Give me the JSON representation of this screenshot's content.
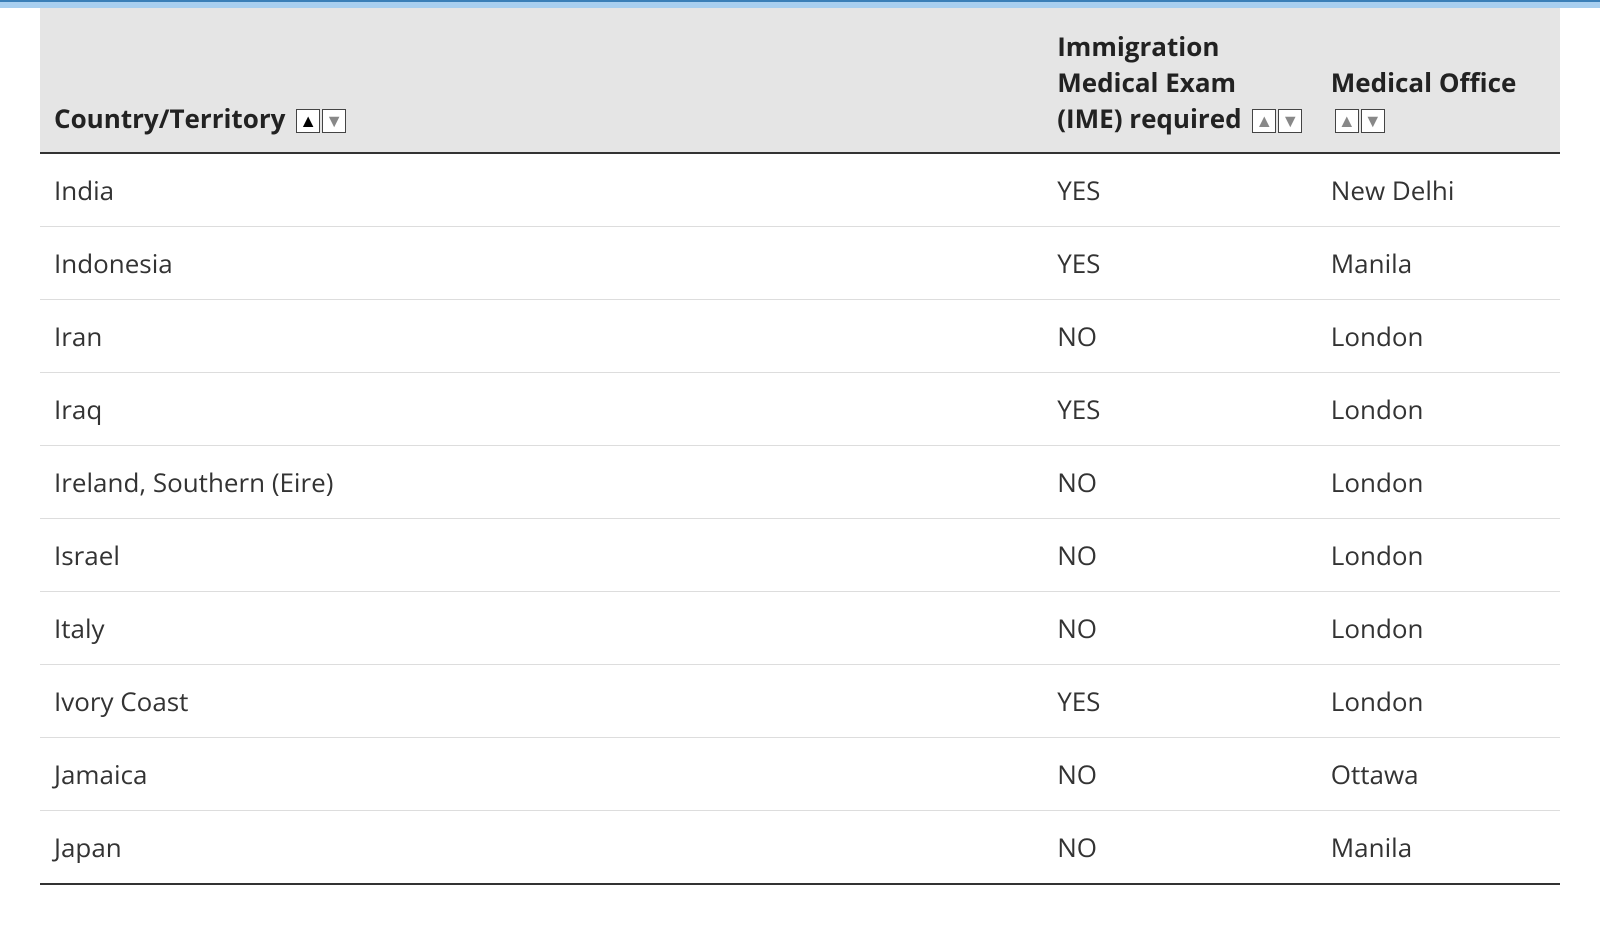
{
  "table": {
    "headers": {
      "country": "Country/Territory",
      "ime": "Immigration Medical Exam (IME) required",
      "office": "Medical Office"
    },
    "rows": [
      {
        "country": "India",
        "ime": "YES",
        "office": "New Delhi"
      },
      {
        "country": "Indonesia",
        "ime": "YES",
        "office": "Manila"
      },
      {
        "country": "Iran",
        "ime": "NO",
        "office": "London"
      },
      {
        "country": "Iraq",
        "ime": "YES",
        "office": "London"
      },
      {
        "country": "Ireland, Southern (Eire)",
        "ime": "NO",
        "office": "London"
      },
      {
        "country": "Israel",
        "ime": "NO",
        "office": "London"
      },
      {
        "country": "Italy",
        "ime": "NO",
        "office": "London"
      },
      {
        "country": "Ivory Coast",
        "ime": "YES",
        "office": "London"
      },
      {
        "country": "Jamaica",
        "ime": "NO",
        "office": "Ottawa"
      },
      {
        "country": "Japan",
        "ime": "NO",
        "office": "Manila"
      }
    ]
  }
}
